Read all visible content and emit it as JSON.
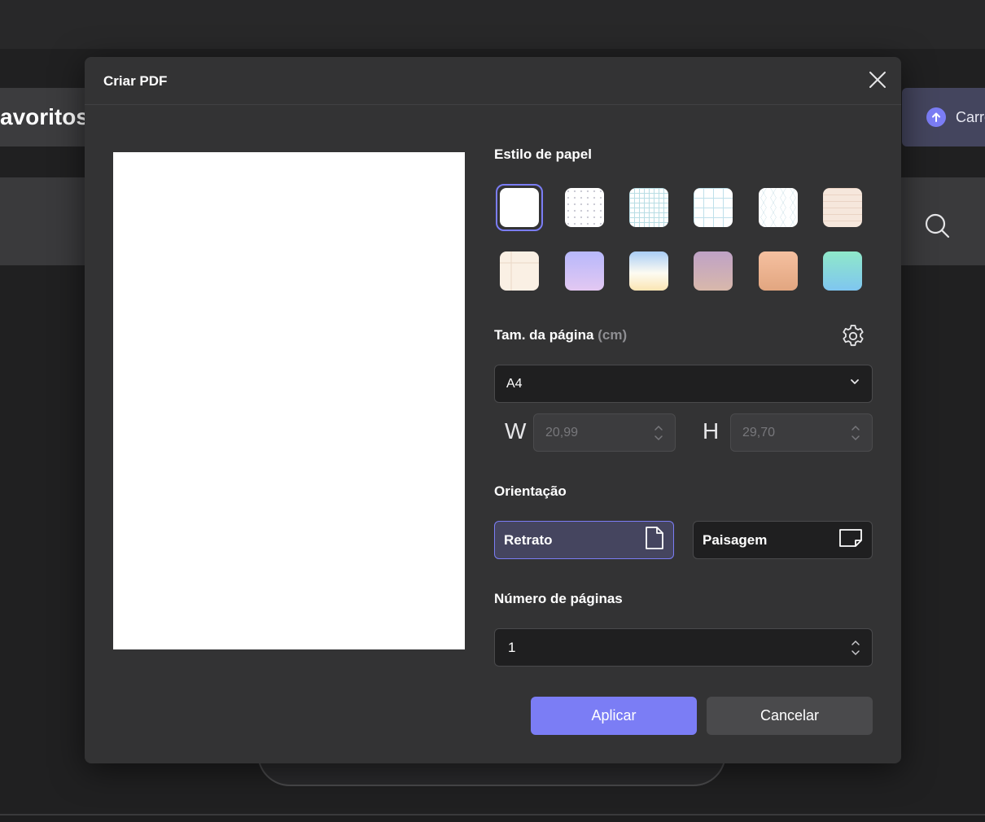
{
  "background": {
    "favorites_label": "avoritos",
    "upload_label": "Carre",
    "search_icon": "search-icon"
  },
  "dialog": {
    "title": "Criar PDF",
    "close_icon": "close-icon",
    "paper_style": {
      "label": "Estilo de papel",
      "swatches": [
        {
          "name": "plain-white",
          "selected": true
        },
        {
          "name": "dot-grid",
          "selected": false
        },
        {
          "name": "small-grid",
          "selected": false
        },
        {
          "name": "large-grid",
          "selected": false
        },
        {
          "name": "isometric-grid",
          "selected": false
        },
        {
          "name": "peach-lined",
          "selected": false
        },
        {
          "name": "cream-corner",
          "selected": false
        },
        {
          "name": "lavender-gradient",
          "selected": false
        },
        {
          "name": "sky-gradient",
          "selected": false
        },
        {
          "name": "mauve-gradient",
          "selected": false
        },
        {
          "name": "apricot-gradient",
          "selected": false
        },
        {
          "name": "mint-gradient",
          "selected": false
        }
      ]
    },
    "page_size": {
      "label": "Tam. da página",
      "unit": "(cm)",
      "settings_icon": "gear-icon",
      "selected": "A4",
      "width_label": "W",
      "width_value": "20,99",
      "height_label": "H",
      "height_value": "29,70"
    },
    "orientation": {
      "label": "Orientação",
      "portrait": "Retrato",
      "landscape": "Paisagem",
      "selected": "portrait"
    },
    "pages": {
      "label": "Número de páginas",
      "value": "1"
    },
    "buttons": {
      "apply": "Aplicar",
      "cancel": "Cancelar"
    }
  },
  "colors": {
    "accent": "#7b7df5",
    "dialog_bg": "#333334",
    "field_bg": "#1f1f20"
  }
}
